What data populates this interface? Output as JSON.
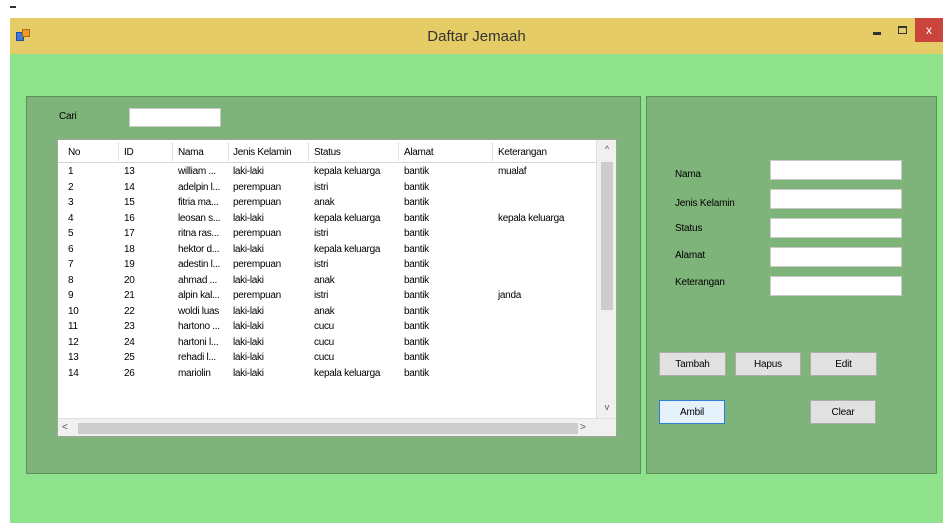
{
  "window": {
    "title": "Daftar Jemaah",
    "close_label": "x"
  },
  "search": {
    "label": "Cari",
    "value": ""
  },
  "grid": {
    "columns": [
      "No",
      "ID",
      "Nama",
      "Jenis Kelamin",
      "Status",
      "Alamat",
      "Keterangan"
    ],
    "rows": [
      [
        "1",
        "13",
        "william ...",
        "laki-laki",
        "kepala keluarga",
        "bantik",
        "mualaf"
      ],
      [
        "2",
        "14",
        "adelpin l...",
        "perempuan",
        "istri",
        "bantik",
        ""
      ],
      [
        "3",
        "15",
        "fitria ma...",
        "perempuan",
        "anak",
        "bantik",
        ""
      ],
      [
        "4",
        "16",
        "leosan s...",
        "laki-laki",
        "kepala keluarga",
        "bantik",
        "kepala keluarga"
      ],
      [
        "5",
        "17",
        "ritna ras...",
        "perempuan",
        "istri",
        "bantik",
        ""
      ],
      [
        "6",
        "18",
        "hektor d...",
        "laki-laki",
        "kepala keluarga",
        "bantik",
        ""
      ],
      [
        "7",
        "19",
        "adestin l...",
        "perempuan",
        "istri",
        "bantik",
        ""
      ],
      [
        "8",
        "20",
        "ahmad ...",
        "laki-laki",
        "anak",
        "bantik",
        ""
      ],
      [
        "9",
        "21",
        "alpin kal...",
        "perempuan",
        "istri",
        "bantik",
        "janda"
      ],
      [
        "10",
        "22",
        "woldi luas",
        "laki-laki",
        "anak",
        "bantik",
        ""
      ],
      [
        "11",
        "23",
        "hartono ...",
        "laki-laki",
        "cucu",
        "bantik",
        ""
      ],
      [
        "12",
        "24",
        "hartoni l...",
        "laki-laki",
        "cucu",
        "bantik",
        ""
      ],
      [
        "13",
        "25",
        "rehadi l...",
        "laki-laki",
        "cucu",
        "bantik",
        ""
      ],
      [
        "14",
        "26",
        "mariolin",
        "laki-laki",
        "kepala keluarga",
        "bantik",
        ""
      ]
    ]
  },
  "form": {
    "nama_label": "Nama",
    "jenis_kelamin_label": "Jenis Kelamin",
    "status_label": "Status",
    "alamat_label": "Alamat",
    "keterangan_label": "Keterangan",
    "nama_value": "",
    "jenis_kelamin_value": "",
    "status_value": "",
    "alamat_value": "",
    "keterangan_value": ""
  },
  "buttons": {
    "tambah": "Tambah",
    "hapus": "Hapus",
    "edit": "Edit",
    "ambil": "Ambil",
    "clear": "Clear"
  },
  "scroll": {
    "up": "^",
    "down": "v",
    "left": "<",
    "right": ">"
  },
  "colors": {
    "titlebar": "#e6cc66",
    "client": "#8de28b",
    "panel": "#7eb37a",
    "close": "#c9443a"
  }
}
